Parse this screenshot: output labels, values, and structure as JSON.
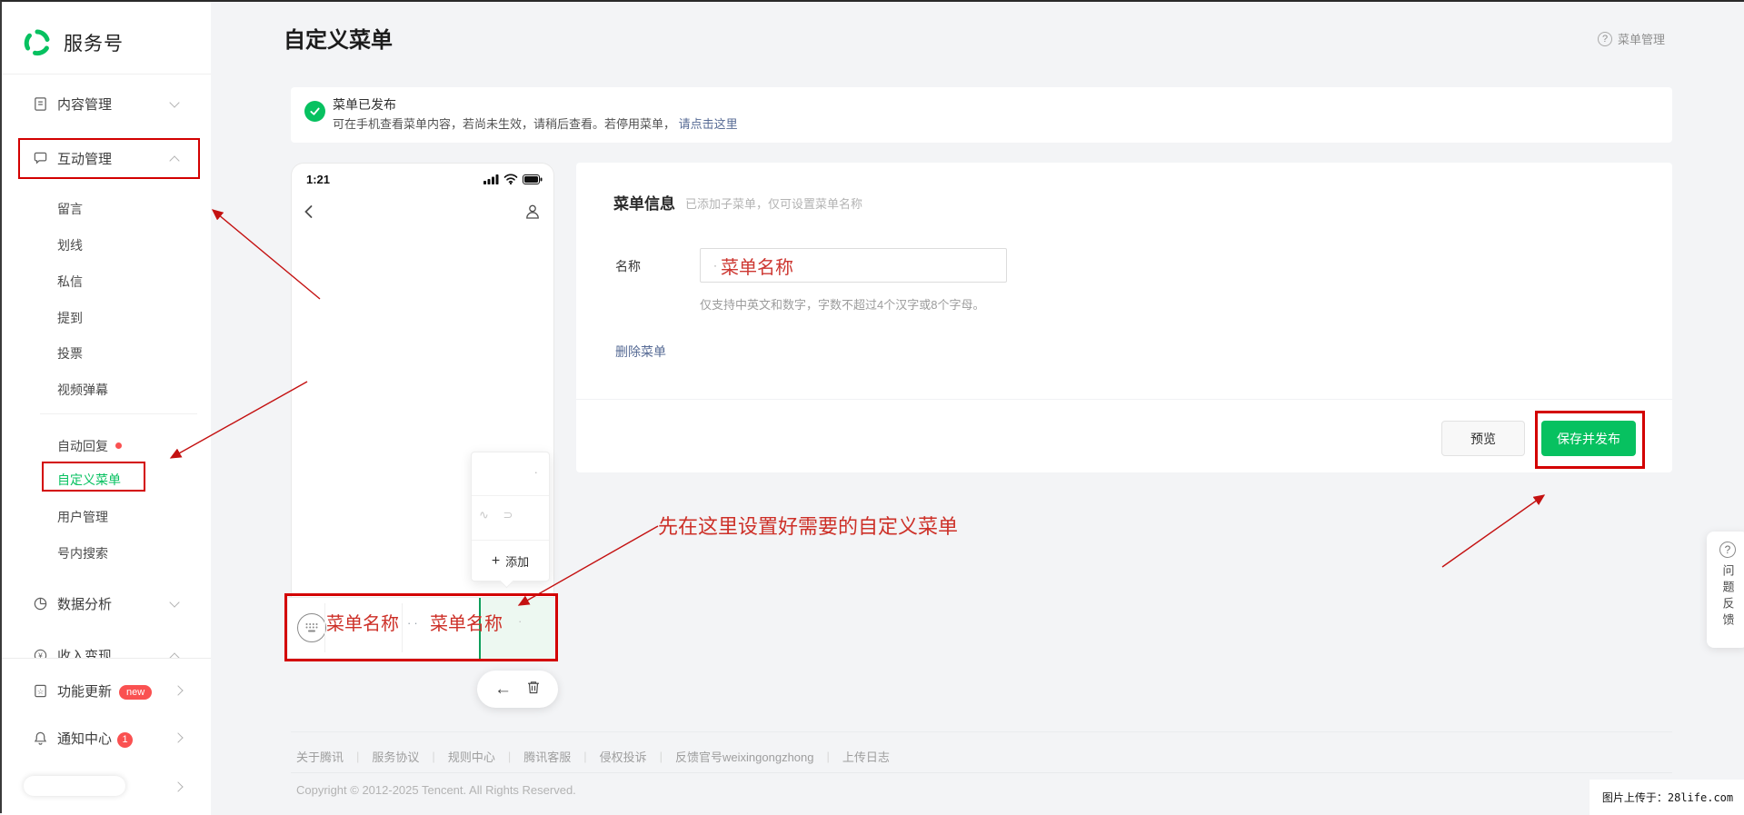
{
  "brand": {
    "name": "服务号"
  },
  "header": {
    "title": "自定义菜单",
    "help_link": "菜单管理"
  },
  "sidebar": {
    "groups": {
      "content": {
        "label": "内容管理"
      },
      "interact": {
        "label": "互动管理"
      },
      "analytics": {
        "label": "数据分析"
      },
      "monetize": {
        "label": "收入变现"
      }
    },
    "interact_items": [
      "留言",
      "划线",
      "私信",
      "提到",
      "投票",
      "视频弹幕"
    ],
    "tool_items": [
      "自动回复",
      "自定义菜单",
      "用户管理",
      "号内搜索"
    ],
    "bottom": {
      "feature": {
        "label": "功能更新",
        "badge": "new"
      },
      "notify": {
        "label": "通知中心",
        "badge": "1"
      }
    }
  },
  "banner": {
    "title": "菜单已发布",
    "desc": "可在手机查看菜单内容，若尚未生效，请稍后查看。若停用菜单，",
    "link": "请点击这里"
  },
  "phone": {
    "time": "1:21",
    "popup": {
      "mark1": "·",
      "mark2": "∿ ⊃",
      "plus": "+",
      "add_label": "添加"
    },
    "menu_bar": {
      "item1": "菜单名称",
      "item2": "菜单名称",
      "dots": "··",
      "dot2": "·"
    },
    "pill": {
      "back_glyph": "←"
    }
  },
  "form": {
    "section_title": "菜单信息",
    "section_hint": "已添加子菜单，仅可设置菜单名称",
    "name_label": "名称",
    "name_tick": "·",
    "name_value": "菜单名称",
    "name_help": "仅支持中英文和数字，字数不超过4个汉字或8个字母。",
    "delete_link": "删除菜单",
    "preview_button": "预览",
    "save_button": "保存并发布"
  },
  "annotation": {
    "tip": "先在这里设置好需要的自定义菜单"
  },
  "footer": {
    "links": [
      "关于腾讯",
      "服务协议",
      "规则中心",
      "腾讯客服",
      "侵权投诉",
      "反馈官号weixingongzhong",
      "上传日志"
    ],
    "separator": "|",
    "copyright": "Copyright © 2012-2025 Tencent. All Rights Reserved."
  },
  "feedback": {
    "icon_glyph": "?",
    "label": "问题反馈"
  },
  "help_icon_glyph": "?",
  "watermark": "图片上传于：28life.com",
  "colors": {
    "brand_green": "#07c160",
    "annotation_red": "#d30000",
    "link_blue": "#576b95",
    "badge_red": "#fa5151",
    "selected_cell_green": "#edf8f1"
  }
}
